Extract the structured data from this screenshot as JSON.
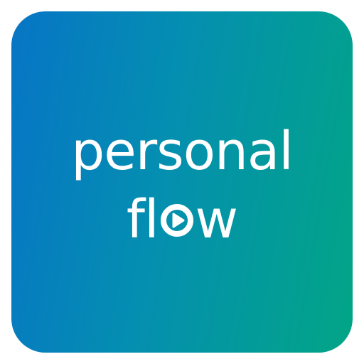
{
  "logo": {
    "line1": "personal",
    "line2_prefix": "fl",
    "line2_suffix": "w",
    "play_icon": "play-circle-icon",
    "colors": {
      "gradient_start": "#0775c6",
      "gradient_end": "#02a586",
      "text": "#ffffff"
    }
  }
}
